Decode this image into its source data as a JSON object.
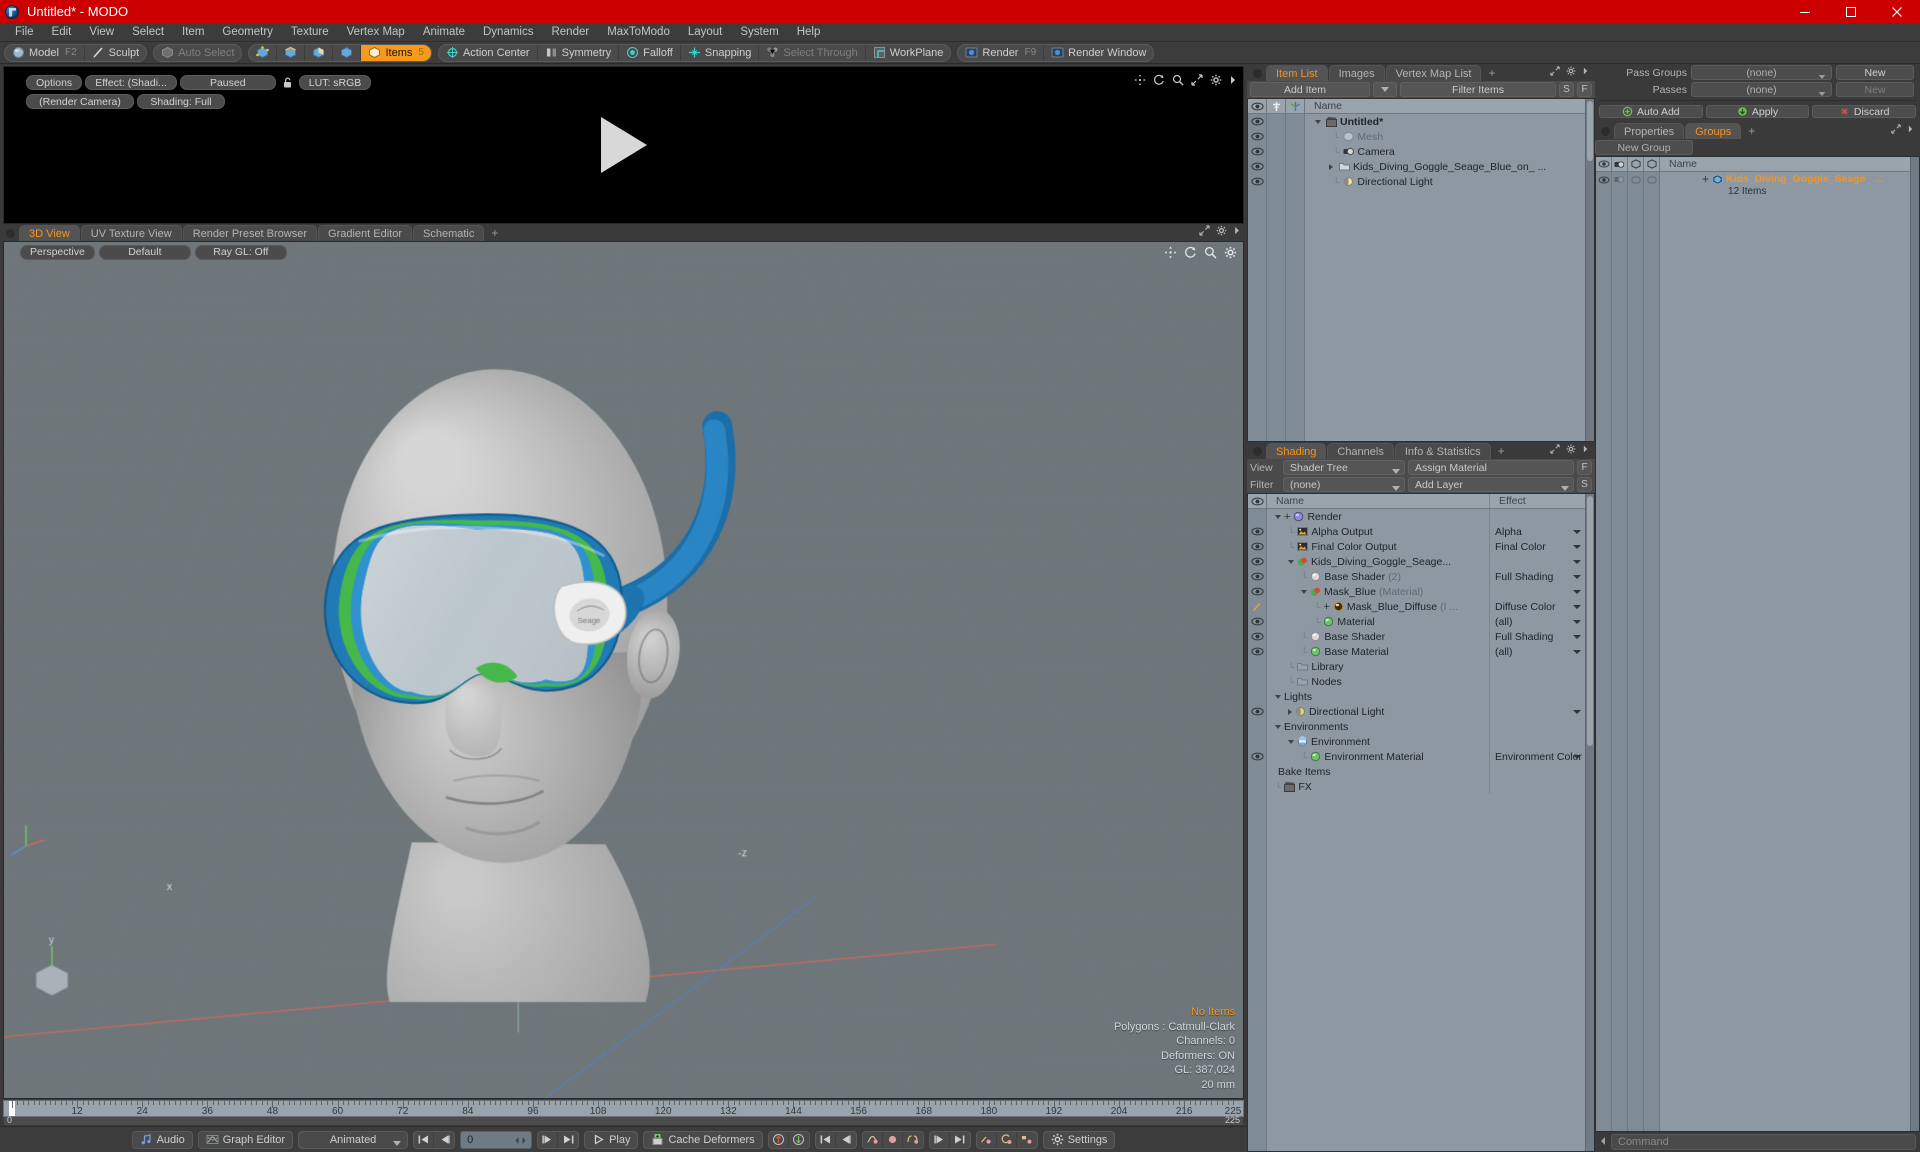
{
  "window": {
    "title": "Untitled* - MODO",
    "logo_icon": "modo-logo-icon",
    "minimize_icon": "minimize-icon",
    "maximize_icon": "maximize-icon",
    "close_icon": "close-icon",
    "titlebar_color": "#cc0000"
  },
  "menu": {
    "items": [
      {
        "label": "File"
      },
      {
        "label": "Edit"
      },
      {
        "label": "View"
      },
      {
        "label": "Select"
      },
      {
        "label": "Item"
      },
      {
        "label": "Geometry"
      },
      {
        "label": "Texture"
      },
      {
        "label": "Vertex Map"
      },
      {
        "label": "Animate"
      },
      {
        "label": "Dynamics"
      },
      {
        "label": "Render"
      },
      {
        "label": "MaxToModo"
      },
      {
        "label": "Layout"
      },
      {
        "label": "System"
      },
      {
        "label": "Help"
      }
    ]
  },
  "toolbar": {
    "groups": [
      {
        "buttons": [
          {
            "label": "Model",
            "shortcut": "F2",
            "icon": "model-sphere-icon",
            "state": "normal"
          },
          {
            "label": "Sculpt",
            "shortcut": "",
            "icon": "sculpt-brush-icon",
            "state": "normal"
          }
        ]
      },
      {
        "buttons": [
          {
            "label": "Auto Select",
            "shortcut": "",
            "icon": "auto-select-icon",
            "state": "dim"
          }
        ]
      },
      {
        "buttons": [
          {
            "label": "",
            "shortcut": "",
            "icon": "vertices-mode-icon",
            "state": "normal"
          },
          {
            "label": "",
            "shortcut": "",
            "icon": "edges-mode-icon",
            "state": "normal"
          },
          {
            "label": "",
            "shortcut": "",
            "icon": "polygons-mode-icon",
            "state": "normal"
          },
          {
            "label": "",
            "shortcut": "",
            "icon": "materials-mode-icon",
            "state": "normal"
          },
          {
            "label": "Items",
            "shortcut": "5",
            "icon": "items-mode-icon",
            "state": "active"
          }
        ]
      },
      {
        "buttons": [
          {
            "label": "Action Center",
            "shortcut": "",
            "icon": "action-center-icon",
            "state": "normal"
          },
          {
            "label": "Symmetry",
            "shortcut": "",
            "icon": "symmetry-icon",
            "state": "normal"
          },
          {
            "label": "Falloff",
            "shortcut": "",
            "icon": "falloff-icon",
            "state": "normal"
          },
          {
            "label": "Snapping",
            "shortcut": "",
            "icon": "snapping-icon",
            "state": "normal"
          },
          {
            "label": "Select Through",
            "shortcut": "",
            "icon": "select-through-icon",
            "state": "dim"
          },
          {
            "label": "WorkPlane",
            "shortcut": "",
            "icon": "workplane-icon",
            "state": "normal"
          }
        ]
      },
      {
        "buttons": [
          {
            "label": "Render",
            "shortcut": "F9",
            "icon": "render-icon",
            "state": "normal"
          },
          {
            "label": "Render Window",
            "shortcut": "",
            "icon": "render-window-icon",
            "state": "normal"
          }
        ]
      }
    ]
  },
  "preview": {
    "controls_top": [
      {
        "label": "Options",
        "name": "options-button"
      },
      {
        "label": "Effect: (Shadi...",
        "name": "effect-button"
      },
      {
        "label": "Paused",
        "name": "paused-button"
      },
      {
        "label": "LUT: sRGB",
        "name": "lut-button"
      }
    ],
    "lock_icon": "unlock-icon",
    "controls_bottom": [
      {
        "label": "(Render Camera)",
        "name": "render-camera-button"
      },
      {
        "label": "Shading: Full",
        "name": "shading-button"
      }
    ],
    "viewport_icons": [
      "pan-icon",
      "rotate-icon",
      "zoom-icon",
      "fit-icon",
      "gear-icon",
      "chevron-right-icon"
    ],
    "play_icon": "play-triangle-icon"
  },
  "viewport_tabs": {
    "tabs": [
      {
        "label": "3D View",
        "selected": true
      },
      {
        "label": "UV Texture View",
        "selected": false
      },
      {
        "label": "Render Preset Browser",
        "selected": false
      },
      {
        "label": "Gradient Editor",
        "selected": false
      },
      {
        "label": "Schematic",
        "selected": false
      }
    ],
    "plus": "+",
    "tools": [
      "expand-icon",
      "gear-icon",
      "chevron-right-icon"
    ]
  },
  "viewport": {
    "controls": [
      {
        "label": "Perspective",
        "name": "projection-button"
      },
      {
        "label": "Default",
        "name": "viewport-style-button"
      },
      {
        "label": "Ray GL: Off",
        "name": "raygl-button"
      }
    ],
    "icons": [
      "pan-icon",
      "rotate-icon",
      "zoom-icon",
      "gear-icon"
    ],
    "axis_labels": {
      "x": "x",
      "y": "y",
      "z": "-z"
    },
    "stats": {
      "selection": "No Items",
      "polygons": "Polygons : Catmull-Clark",
      "channels": "Channels: 0",
      "deformers": "Deformers: ON",
      "gl": "GL: 387,024",
      "grid": "20 mm"
    }
  },
  "timeline": {
    "labels": [
      "0",
      "12",
      "24",
      "36",
      "48",
      "60",
      "72",
      "84",
      "96",
      "108",
      "120",
      "132",
      "144",
      "156",
      "168",
      "180",
      "192",
      "204",
      "216",
      "225"
    ],
    "range_start": "0",
    "range_end": "225",
    "current_frame": "0",
    "end_marker": "225"
  },
  "bottombar": {
    "audio_label": "Audio",
    "audio_icon": "audio-note-icon",
    "graph_editor_label": "Graph Editor",
    "graph_editor_icon": "graph-editor-icon",
    "mode_value": "Animated",
    "frame_value": "0",
    "play_label": "Play",
    "play_icon": "play-icon",
    "cache_deformers_label": "Cache Deformers",
    "cache_deformers_icon": "cache-icon",
    "settings_label": "Settings",
    "settings_icon": "gear-icon",
    "transport": [
      {
        "name": "go-to-start-button",
        "icon": "skip-start-icon"
      },
      {
        "name": "step-back-button",
        "icon": "step-back-icon"
      },
      {
        "name": "step-forward-button",
        "icon": "step-forward-icon"
      },
      {
        "name": "go-to-end-button",
        "icon": "skip-end-icon"
      }
    ],
    "key_tools": [
      {
        "name": "load-up-button",
        "icon": "arrow-up-circle-icon"
      },
      {
        "name": "load-down-button",
        "icon": "arrow-down-circle-icon"
      },
      {
        "name": "prev-key-button",
        "icon": "prev-key-icon"
      },
      {
        "name": "prev-key2-button",
        "icon": "prev-key2-icon"
      },
      {
        "name": "curve-key-button",
        "icon": "curve-key-icon"
      },
      {
        "name": "add-key-button",
        "icon": "add-key-icon"
      },
      {
        "name": "key-range-button",
        "icon": "key-range-icon"
      },
      {
        "name": "next-key-button",
        "icon": "next-key-icon"
      },
      {
        "name": "next-key2-button",
        "icon": "next-key2-icon"
      },
      {
        "name": "slope-key-button",
        "icon": "slope-key-icon"
      },
      {
        "name": "cycle-key-button",
        "icon": "cycle-key-icon"
      },
      {
        "name": "step-key-button",
        "icon": "step-key-icon"
      }
    ]
  },
  "item_list": {
    "tabs": [
      {
        "label": "Item List",
        "selected": true
      },
      {
        "label": "Images",
        "selected": false
      },
      {
        "label": "Vertex Map List",
        "selected": false
      }
    ],
    "plus": "+",
    "add_item_label": "Add Item",
    "filter_placeholder": "Filter Items",
    "btn_s": "S",
    "btn_f": "F",
    "columns": [
      "Name"
    ],
    "gutter_icons": [
      "eye-icon",
      "lock-icon",
      "axis-icon"
    ],
    "rows": [
      {
        "label": "Untitled*",
        "icon": "scene-clapper-icon",
        "depth": 0,
        "bold": true,
        "expander": "down",
        "dim": false
      },
      {
        "label": "Mesh",
        "icon": "mesh-cube-icon",
        "depth": 1,
        "bold": false,
        "expander": "none",
        "dim": true
      },
      {
        "label": "Camera",
        "icon": "camera-icon",
        "depth": 1,
        "bold": false,
        "expander": "none",
        "dim": false
      },
      {
        "label": "Kids_Diving_Goggle_Seage_Blue_on_ ...",
        "icon": "group-folder-icon",
        "depth": 1,
        "bold": false,
        "expander": "right",
        "dim": false
      },
      {
        "label": "Directional Light",
        "icon": "light-icon",
        "depth": 1,
        "bold": false,
        "expander": "none",
        "dim": false
      }
    ]
  },
  "shading": {
    "tabs": [
      {
        "label": "Shading",
        "selected": true
      },
      {
        "label": "Channels",
        "selected": false
      },
      {
        "label": "Info & Statistics",
        "selected": false
      }
    ],
    "plus": "+",
    "view_label": "View",
    "view_value": "Shader Tree",
    "assign_material_label": "Assign Material",
    "btn_f": "F",
    "filter_label": "Filter",
    "filter_value": "(none)",
    "add_layer_label": "Add Layer",
    "btn_s": "S",
    "columns": [
      "Name",
      "Effect"
    ],
    "rows": [
      {
        "name": "Render",
        "effect": "",
        "depth": 0,
        "icon": "render-globe-icon",
        "icon_color": "#8f8ad8",
        "expander": "down",
        "eye": false,
        "plus": true,
        "suffix": ""
      },
      {
        "name": "Alpha Output",
        "effect": "Alpha",
        "depth": 1,
        "icon": "output-image-icon",
        "icon_color": "#d9a23a",
        "expander": "none",
        "eye": true,
        "plus": false,
        "suffix": ""
      },
      {
        "name": "Final Color Output",
        "effect": "Final Color",
        "depth": 1,
        "icon": "output-image-icon",
        "icon_color": "#d9a23a",
        "expander": "none",
        "eye": true,
        "plus": false,
        "suffix": ""
      },
      {
        "name": "Kids_Diving_Goggle_Seage...",
        "effect": "",
        "depth": 1,
        "icon": "material-group-icon",
        "icon_color": "#4fa84f",
        "expander": "down",
        "eye": true,
        "plus": false,
        "suffix": ""
      },
      {
        "name": "Base Shader",
        "effect": "Full Shading",
        "depth": 2,
        "icon": "shader-sphere-icon",
        "icon_color": "#d8d8d8",
        "expander": "none",
        "eye": true,
        "plus": false,
        "suffix": "(2)"
      },
      {
        "name": "Mask_Blue",
        "effect": "",
        "depth": 2,
        "icon": "material-group-icon",
        "icon_color": "#4fa84f",
        "expander": "down",
        "eye": true,
        "plus": false,
        "suffix": "(Material)"
      },
      {
        "name": "Mask_Blue_Diffuse",
        "effect": "Diffuse Color",
        "depth": 3,
        "icon": "image-map-icon",
        "icon_color": "#b08840",
        "expander": "none",
        "eye": false,
        "plus": true,
        "suffix": "(I ..."
      },
      {
        "name": "Material",
        "effect": "(all)",
        "depth": 3,
        "icon": "material-sphere-icon",
        "icon_color": "#6fc06f",
        "expander": "none",
        "eye": true,
        "plus": false,
        "suffix": ""
      },
      {
        "name": "Base Shader",
        "effect": "Full Shading",
        "depth": 2,
        "icon": "shader-sphere-icon",
        "icon_color": "#d8d8d8",
        "expander": "none",
        "eye": true,
        "plus": false,
        "suffix": ""
      },
      {
        "name": "Base Material",
        "effect": "(all)",
        "depth": 2,
        "icon": "material-sphere-icon",
        "icon_color": "#6fc06f",
        "expander": "none",
        "eye": true,
        "plus": false,
        "suffix": ""
      },
      {
        "name": "Library",
        "effect": "",
        "depth": 1,
        "icon": "folder-icon",
        "icon_color": "#9aa4ad",
        "expander": "none",
        "eye": false,
        "plus": false,
        "suffix": ""
      },
      {
        "name": "Nodes",
        "effect": "",
        "depth": 1,
        "icon": "folder-icon",
        "icon_color": "#9aa4ad",
        "expander": "none",
        "eye": false,
        "plus": false,
        "suffix": ""
      },
      {
        "name": "Lights",
        "effect": "",
        "depth": 0,
        "icon": "none",
        "icon_color": "",
        "expander": "down",
        "eye": false,
        "plus": false,
        "suffix": ""
      },
      {
        "name": "Directional Light",
        "effect": "",
        "depth": 1,
        "icon": "light-icon",
        "icon_color": "#e6d27a",
        "expander": "right",
        "eye": true,
        "plus": false,
        "suffix": ""
      },
      {
        "name": "Environments",
        "effect": "",
        "depth": 0,
        "icon": "none",
        "icon_color": "",
        "expander": "down",
        "eye": false,
        "plus": false,
        "suffix": ""
      },
      {
        "name": "Environment",
        "effect": "",
        "depth": 1,
        "icon": "environment-icon",
        "icon_color": "#7aa8d8",
        "expander": "down",
        "eye": false,
        "plus": false,
        "suffix": ""
      },
      {
        "name": "Environment Material",
        "effect": "Environment Color",
        "depth": 2,
        "icon": "material-sphere-icon",
        "icon_color": "#6fc06f",
        "expander": "none",
        "eye": true,
        "plus": false,
        "suffix": ""
      },
      {
        "name": "Bake Items",
        "effect": "",
        "depth": 0,
        "icon": "none",
        "icon_color": "",
        "expander": "none",
        "eye": false,
        "plus": false,
        "suffix": ""
      },
      {
        "name": "FX",
        "effect": "",
        "depth": 0,
        "icon": "fx-clapper-icon",
        "icon_color": "#b4b4b4",
        "expander": "none",
        "eye": false,
        "plus": false,
        "suffix": ""
      }
    ]
  },
  "passes": {
    "pass_groups_label": "Pass Groups",
    "pass_groups_value": "(none)",
    "pass_groups_new": "New",
    "passes_label": "Passes",
    "passes_value": "(none)",
    "passes_new": "New",
    "auto_add_label": "Auto Add",
    "auto_add_icon": "auto-add-icon",
    "apply_label": "Apply",
    "apply_icon": "apply-down-icon",
    "discard_label": "Discard",
    "discard_icon": "discard-x-icon"
  },
  "groups_panel": {
    "tabs": [
      {
        "label": "Properties",
        "selected": false
      },
      {
        "label": "Groups",
        "selected": true
      }
    ],
    "plus": "+",
    "new_group_label": "New Group",
    "gutter_icons": [
      "eye-icon",
      "camera-icon",
      "render-cube-icon",
      "select-cube-icon"
    ],
    "columns": [
      "Name"
    ],
    "rows": [
      {
        "label": "Kids_Diving_Goggle_Seage_ ...",
        "sub": "12 Items",
        "icon": "group-item-icon",
        "selected": true
      }
    ]
  },
  "command_bar": {
    "placeholder": "Command",
    "left_icon": "chevron-left-icon",
    "right_icon": "chevron-right-icon"
  },
  "colors": {
    "accent_orange": "#f7941e",
    "title_red": "#cc0000",
    "panel_bg": "#3a3a3a",
    "list_bg": "#8d98a2",
    "viewport_bg": "#6c7478",
    "teal": "#3fd0c9"
  }
}
